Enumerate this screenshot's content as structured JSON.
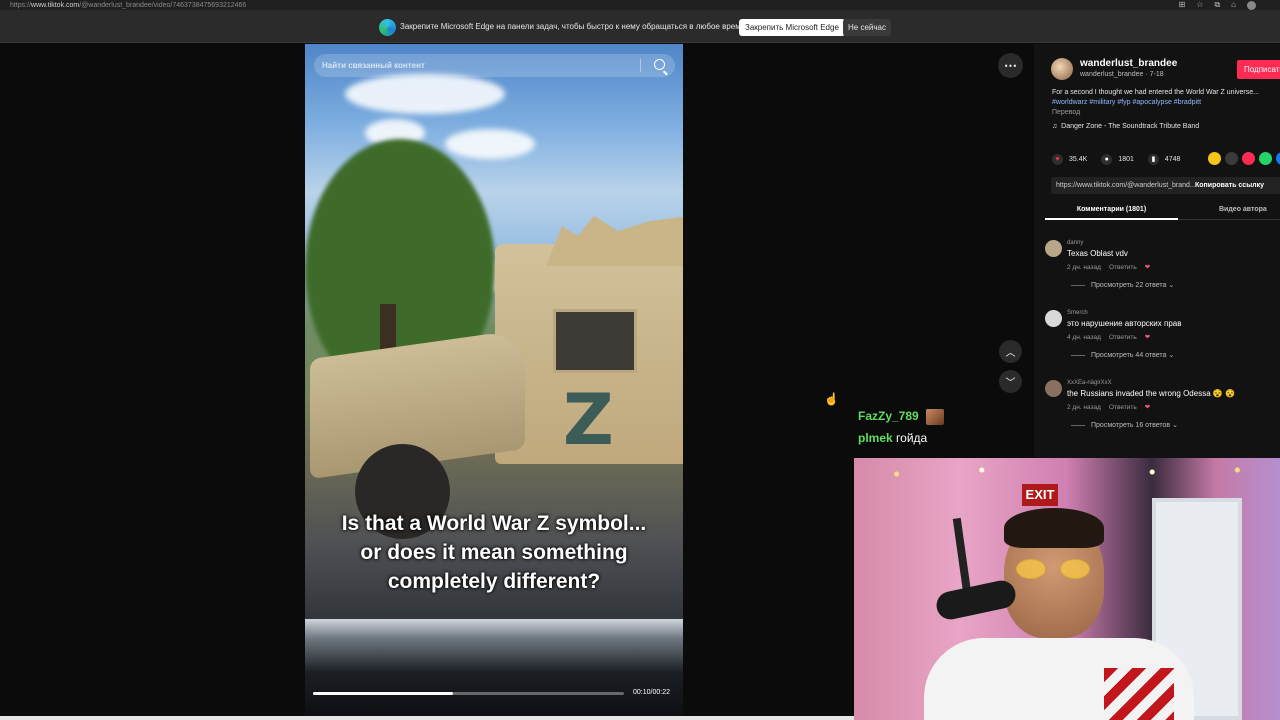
{
  "browser": {
    "url_prefix": "https://",
    "url_domain": "www.tiktok.com",
    "url_path": "/@wanderlust_brandee/video/7463738475693212466"
  },
  "edge_banner": {
    "message": "Закрепите Microsoft Edge на панели задач, чтобы быстро к нему обращаться в любое время",
    "pin_label": "Закрепить Microsoft Edge",
    "later_label": "Не сейчас"
  },
  "video": {
    "search_placeholder": "Найти связанный контент",
    "caption_lines": [
      "Is that a World War Z symbol...",
      "or does it mean something",
      "completely different?"
    ],
    "timecode": "00:10/00:22",
    "progress": 0.45,
    "vehicle_symbol": "Z"
  },
  "chat": [
    {
      "user": "FazZy_789",
      "message": ""
    },
    {
      "user": "plmek",
      "message": "гойда"
    }
  ],
  "post": {
    "author_name": "wanderlust_brandee",
    "author_sub": "wanderlust_brandee · 7-18",
    "follow_label": "Подписаться",
    "description": "For a second I thought we had entered the World War Z universe...",
    "hashtags": "#worldwarz #military #fyp #apocalypse #bradpitt",
    "translate_label": "Перевод",
    "music": "Danger Zone - The Soundtrack Tribute Band",
    "likes": "35.4K",
    "comments_count": "1801",
    "saves": "4748",
    "link": "https://www.tiktok.com/@wanderlust_brand...",
    "copy_label": "Копировать ссылку"
  },
  "tabs": {
    "comments": "Комментарии (1801)",
    "videos": "Видео автора"
  },
  "comments": [
    {
      "user": "danny",
      "text": "Texas Oblast vdv",
      "time": "2 дн. назад",
      "reply": "Ответить",
      "replies": "Просмотреть 22 ответа",
      "avatar_color": "#b8a58a"
    },
    {
      "user": "Smerch",
      "text": "это нарушение авторских прав",
      "time": "4 дн. назад",
      "reply": "Ответить",
      "replies": "Просмотреть 44 ответа",
      "avatar_color": "#d9d9d9"
    },
    {
      "user": "XxXEa-nägirXxX",
      "text": "the Russians invaded the wrong Odessa 😵 😵",
      "time": "2 дн. назад",
      "reply": "Ответить",
      "replies": "Просмотреть 16 ответов",
      "avatar_color": "#8a7060"
    }
  ],
  "colors": {
    "follow": "#fe2c55",
    "chat_username": "#5ee05e",
    "hashtag": "#8fb8ff"
  }
}
